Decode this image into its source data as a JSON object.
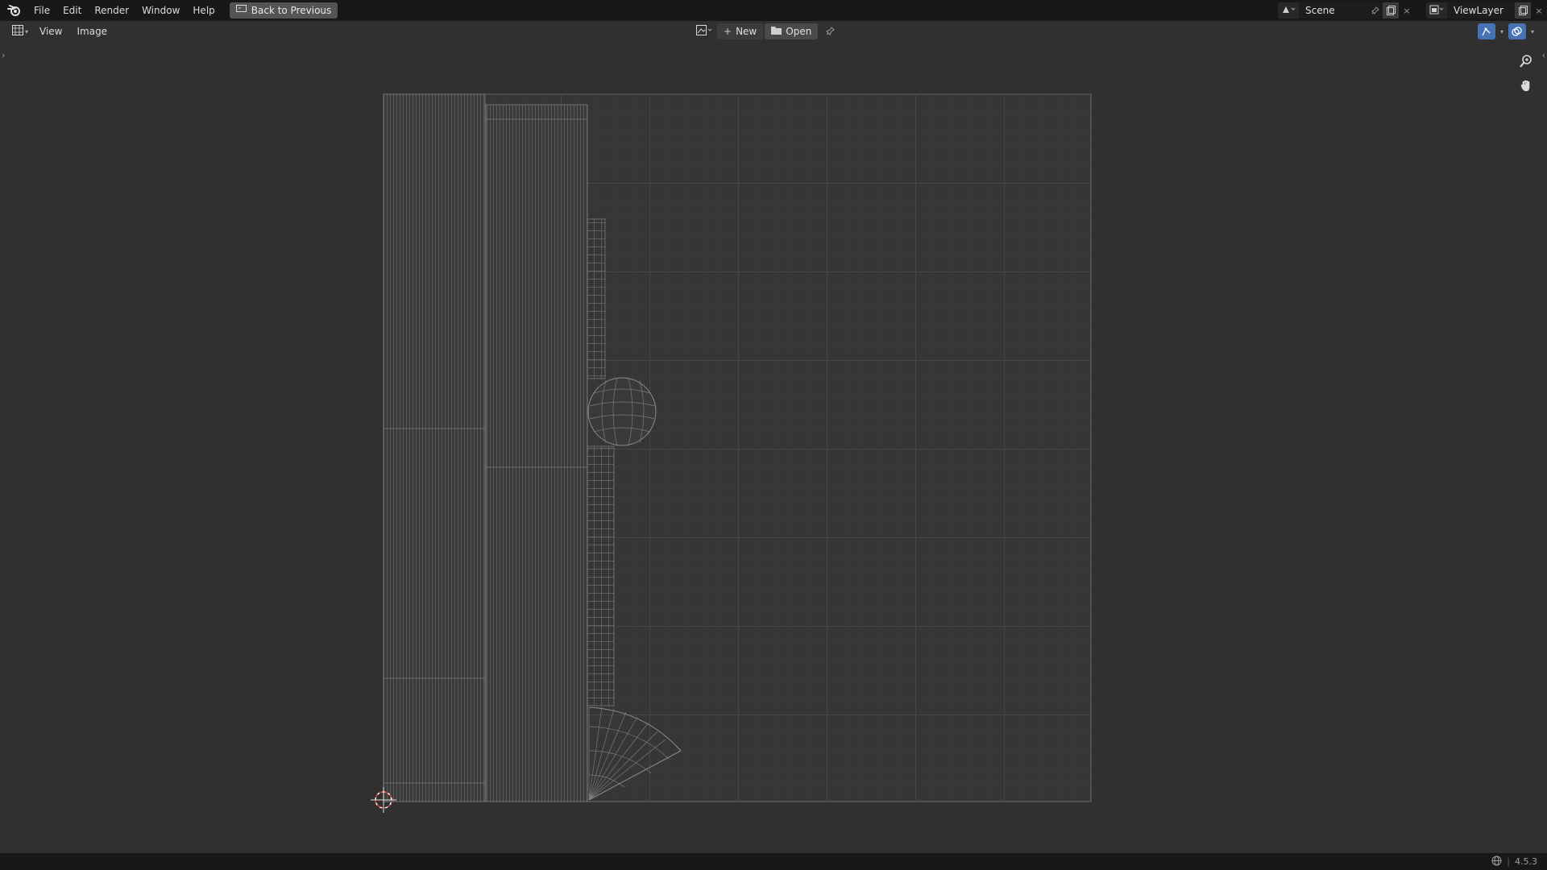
{
  "topbar": {
    "menus": [
      "File",
      "Edit",
      "Render",
      "Window",
      "Help"
    ],
    "back_button": "Back to Previous",
    "scene": "Scene",
    "view_layer": "ViewLayer"
  },
  "editor_header": {
    "menus": [
      "View",
      "Image"
    ],
    "new_label": "New",
    "open_label": "Open"
  },
  "colors": {
    "topbar_bg": "#181818",
    "viewport_bg": "#303030",
    "uv_area_bg": "#383838",
    "wireframe": "#8a8a8a",
    "accent_blue": "#4772b3",
    "cursor_red": "#e04040"
  },
  "statusbar": {
    "version": "4.5.3"
  }
}
